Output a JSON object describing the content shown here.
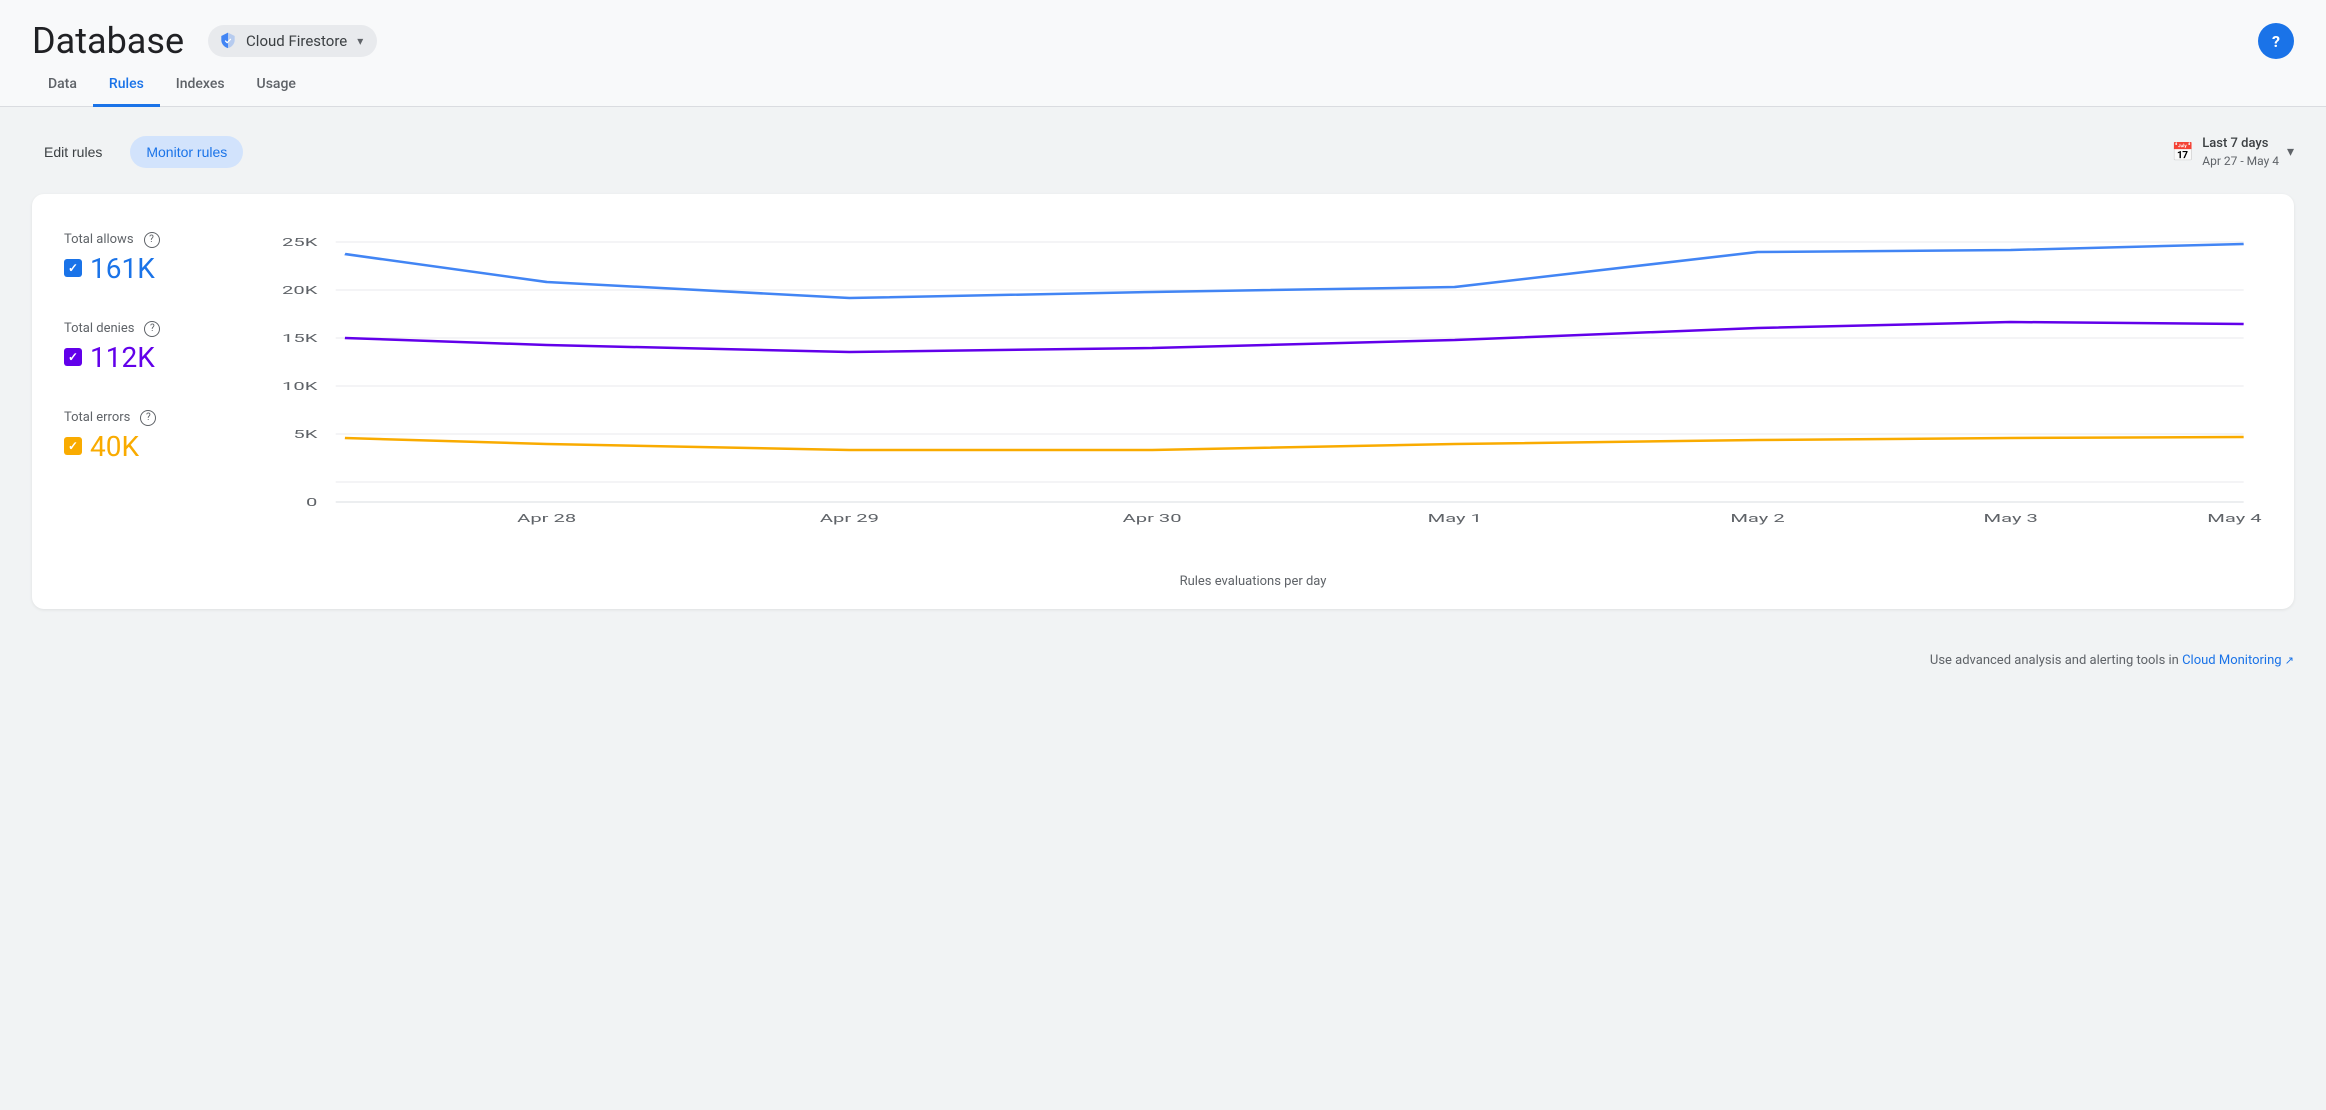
{
  "header": {
    "title": "Database",
    "product": "Cloud Firestore",
    "help_label": "?"
  },
  "nav": {
    "tabs": [
      {
        "id": "data",
        "label": "Data",
        "active": false
      },
      {
        "id": "rules",
        "label": "Rules",
        "active": true
      },
      {
        "id": "indexes",
        "label": "Indexes",
        "active": false
      },
      {
        "id": "usage",
        "label": "Usage",
        "active": false
      }
    ]
  },
  "toolbar": {
    "edit_rules_label": "Edit rules",
    "monitor_rules_label": "Monitor rules",
    "date_range_main": "Last 7 days",
    "date_range_sub": "Apr 27 - May 4"
  },
  "chart": {
    "title": "Rules evaluations per day",
    "y_labels": [
      "25K",
      "20K",
      "15K",
      "10K",
      "5K",
      "0"
    ],
    "x_labels": [
      "Apr 28",
      "Apr 29",
      "Apr 30",
      "May 1",
      "May 2",
      "May 3",
      "May 4"
    ],
    "legend": [
      {
        "id": "allows",
        "label": "Total allows",
        "value": "161K",
        "color_class": "blue",
        "checkbox_class": "checkbox-blue",
        "line_color": "#4285f4"
      },
      {
        "id": "denies",
        "label": "Total denies",
        "value": "112K",
        "color_class": "purple",
        "checkbox_class": "checkbox-purple",
        "line_color": "#6200ea"
      },
      {
        "id": "errors",
        "label": "Total errors",
        "value": "40K",
        "color_class": "yellow",
        "checkbox_class": "checkbox-yellow",
        "line_color": "#f9ab00"
      }
    ]
  },
  "footer": {
    "note_text": "Use advanced analysis and alerting tools in",
    "link_text": "Cloud Monitoring",
    "link_icon": "↗"
  }
}
